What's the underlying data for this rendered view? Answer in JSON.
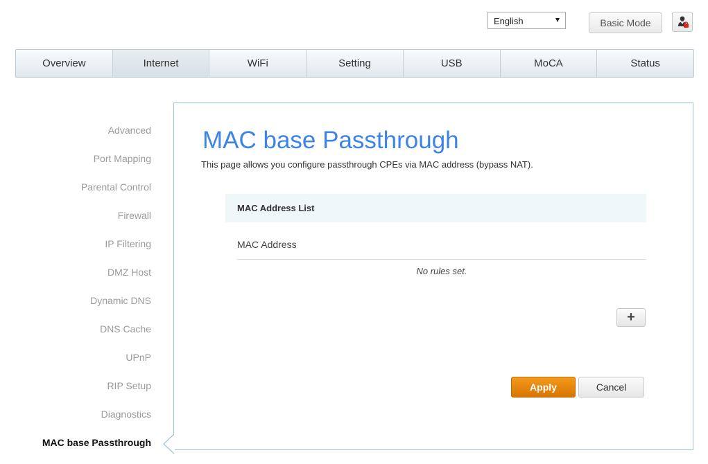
{
  "header": {
    "language": "English",
    "mode_button": "Basic Mode",
    "user_icon": "user-icon"
  },
  "nav": {
    "tabs": [
      {
        "label": "Overview"
      },
      {
        "label": "Internet"
      },
      {
        "label": "WiFi"
      },
      {
        "label": "Setting"
      },
      {
        "label": "USB"
      },
      {
        "label": "MoCA"
      },
      {
        "label": "Status"
      }
    ],
    "active": "Internet"
  },
  "sidebar": {
    "items": [
      {
        "label": "Advanced"
      },
      {
        "label": "Port Mapping"
      },
      {
        "label": "Parental Control"
      },
      {
        "label": "Firewall"
      },
      {
        "label": "IP Filtering"
      },
      {
        "label": "DMZ Host"
      },
      {
        "label": "Dynamic DNS"
      },
      {
        "label": "DNS Cache"
      },
      {
        "label": "UPnP"
      },
      {
        "label": "RIP Setup"
      },
      {
        "label": "Diagnostics"
      },
      {
        "label": "MAC base Passthrough"
      }
    ],
    "active": "MAC base Passthrough"
  },
  "main": {
    "title": "MAC base Passthrough",
    "description": "This page allows you configure passthrough CPEs via MAC address (bypass NAT).",
    "list_title": "MAC Address List",
    "column_header": "MAC Address",
    "empty_message": "No rules set.",
    "add_button": "+",
    "apply_button": "Apply",
    "cancel_button": "Cancel"
  },
  "colors": {
    "title_blue": "#3d84e6",
    "apply_orange": "#e8860f",
    "panel_border": "#9cc3dd"
  }
}
